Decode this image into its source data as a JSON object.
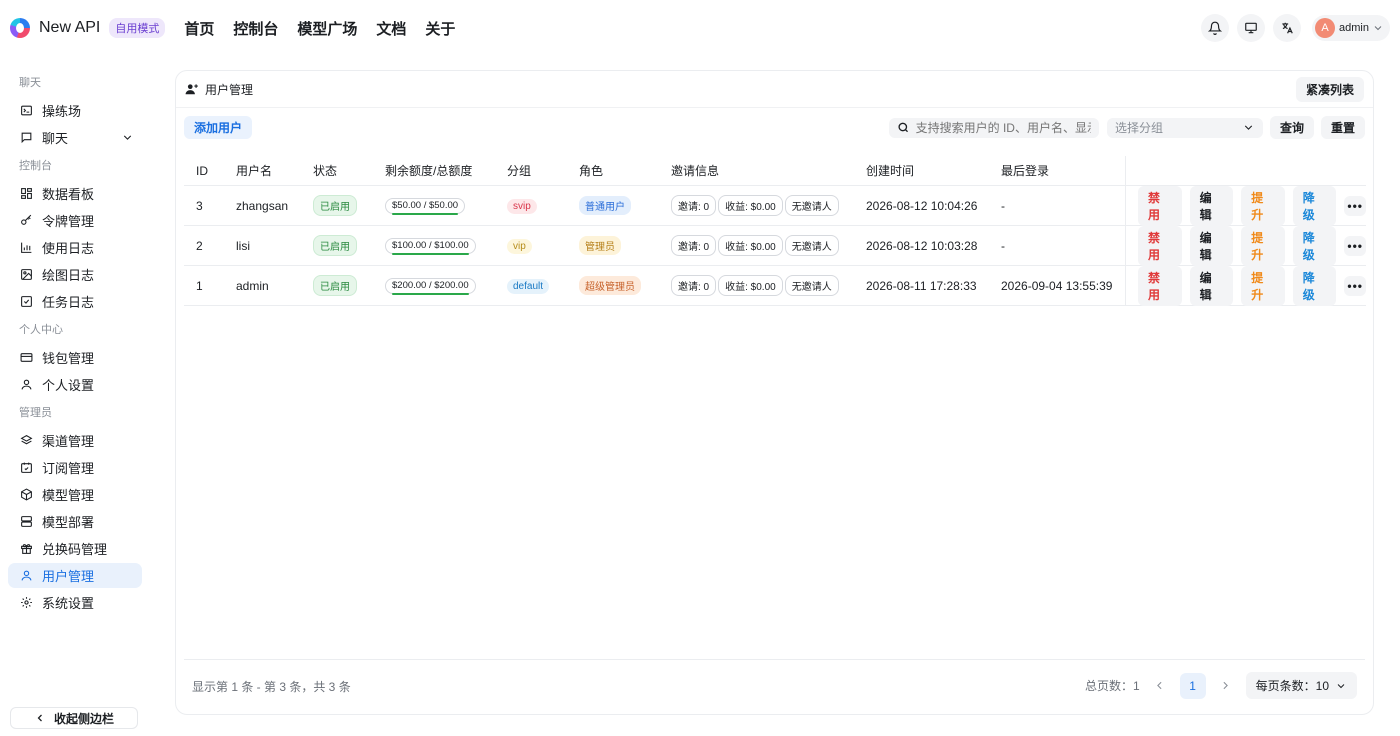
{
  "header": {
    "brand": "New API",
    "mode_badge": "自用模式",
    "nav": [
      "首页",
      "控制台",
      "模型广场",
      "文档",
      "关于"
    ],
    "user": {
      "avatar_letter": "A",
      "name": "admin"
    }
  },
  "sidebar": {
    "groups": [
      {
        "title": "聊天",
        "items": [
          {
            "label": "操练场",
            "icon": "playground-icon"
          },
          {
            "label": "聊天",
            "icon": "chat-icon",
            "expandable": true
          }
        ]
      },
      {
        "title": "控制台",
        "items": [
          {
            "label": "数据看板",
            "icon": "dashboard-icon"
          },
          {
            "label": "令牌管理",
            "icon": "key-icon"
          },
          {
            "label": "使用日志",
            "icon": "bar-chart-icon"
          },
          {
            "label": "绘图日志",
            "icon": "image-icon"
          },
          {
            "label": "任务日志",
            "icon": "task-icon"
          }
        ]
      },
      {
        "title": "个人中心",
        "items": [
          {
            "label": "钱包管理",
            "icon": "wallet-icon"
          },
          {
            "label": "个人设置",
            "icon": "user-icon"
          }
        ]
      },
      {
        "title": "管理员",
        "items": [
          {
            "label": "渠道管理",
            "icon": "layers-icon"
          },
          {
            "label": "订阅管理",
            "icon": "subscription-icon"
          },
          {
            "label": "模型管理",
            "icon": "cube-icon"
          },
          {
            "label": "模型部署",
            "icon": "server-icon"
          },
          {
            "label": "兑换码管理",
            "icon": "gift-icon"
          },
          {
            "label": "用户管理",
            "icon": "user-icon",
            "active": true
          },
          {
            "label": "系统设置",
            "icon": "gear-icon"
          }
        ]
      }
    ],
    "collapse_label": "收起侧边栏"
  },
  "card": {
    "title": "用户管理",
    "compact_label": "紧凑列表",
    "add_label": "添加用户",
    "search_placeholder": "支持搜索用户的 ID、用户名、显示",
    "group_placeholder": "选择分组",
    "query_label": "查询",
    "reset_label": "重置"
  },
  "table": {
    "columns": [
      "ID",
      "用户名",
      "状态",
      "剩余额度/总额度",
      "分组",
      "角色",
      "邀请信息",
      "创建时间",
      "最后登录"
    ],
    "rows": [
      {
        "id": "3",
        "username": "zhangsan",
        "status": "已启用",
        "quota": "$50.00 / $50.00",
        "quota_fraction": 1.0,
        "group": "svip",
        "group_color": "red",
        "role": "普通用户",
        "role_color": "blue",
        "invite": [
          "邀请: 0",
          "收益: $0.00",
          "无邀请人"
        ],
        "created": "2026-08-12 10:04:26",
        "last_login": "-"
      },
      {
        "id": "2",
        "username": "lisi",
        "status": "已启用",
        "quota": "$100.00 / $100.00",
        "quota_fraction": 1.0,
        "group": "vip",
        "group_color": "yellow",
        "role": "管理员",
        "role_color": "yellow",
        "invite": [
          "邀请: 0",
          "收益: $0.00",
          "无邀请人"
        ],
        "created": "2026-08-12 10:03:28",
        "last_login": "-"
      },
      {
        "id": "1",
        "username": "admin",
        "status": "已启用",
        "quota": "$200.00 / $200.00",
        "quota_fraction": 1.0,
        "group": "default",
        "group_color": "blue",
        "role": "超级管理员",
        "role_color": "orange",
        "invite": [
          "邀请: 0",
          "收益: $0.00",
          "无邀请人"
        ],
        "created": "2026-08-11 17:28:33",
        "last_login": "2026-09-04 13:55:39"
      }
    ],
    "actions": [
      "禁用",
      "编辑",
      "提升",
      "降级"
    ],
    "more_label": "•••"
  },
  "footer": {
    "info": "显示第 1 条 - 第 3 条，共 3 条",
    "total_pages": "总页数：1",
    "current_page": "1",
    "per_page": "每页条数：10"
  }
}
